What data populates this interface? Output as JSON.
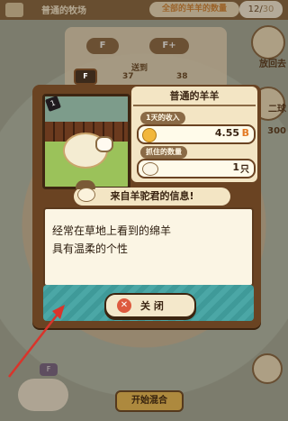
{
  "topbar": {
    "farm_name": "普通的牧场",
    "all_sheep_label": "全部的羊羊的数量",
    "count_current": "12",
    "count_sep": "/",
    "count_total": "30"
  },
  "background": {
    "chip_f": "F",
    "chip_fplus": "F+",
    "sub_label": "送到",
    "num_1": "37",
    "num_2": "38",
    "side_release": "放回去",
    "side_ticket": "二球",
    "side_count": "300",
    "bottom_chip": "F",
    "start_mix": "开始混合"
  },
  "dialog": {
    "grade_tab": "F",
    "rarity": "1",
    "sheep_name": "普通的羊羊",
    "income_label": "1天的收入",
    "income_value": "4.55",
    "income_unit": "B",
    "caught_label": "抓住的数量",
    "caught_value": "1",
    "caught_unit": "只",
    "message_title": "来自羊驼君的信息!",
    "message_body": "经常在草地上看到的绵羊\n具有温柔的个性",
    "close_label": "关 闭"
  },
  "colors": {
    "panel_brown": "#6a4322",
    "cream": "#f3e5c4",
    "teal_strip": "#4ba7a6",
    "close_red": "#dd5a3f",
    "coin": "#f2b73b",
    "arrow_red": "#d9342b"
  }
}
